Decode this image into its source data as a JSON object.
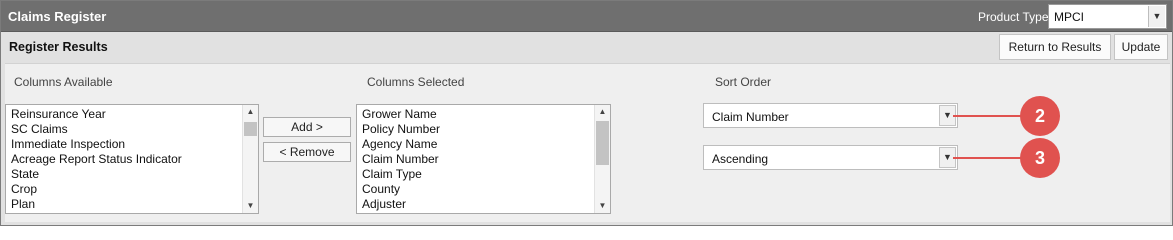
{
  "header": {
    "title": "Claims Register",
    "product_type_label": "Product Type",
    "product_type_value": "MPCI"
  },
  "results": {
    "title": "Register Results",
    "return_label": "Return to Results",
    "update_label": "Update"
  },
  "columns_available": {
    "heading": "Columns Available",
    "items": [
      "Reinsurance Year",
      "SC Claims",
      "Immediate Inspection",
      "Acreage Report Status Indicator",
      "State",
      "Crop",
      "Plan"
    ]
  },
  "actions": {
    "add_label": "Add >",
    "remove_label": "< Remove"
  },
  "columns_selected": {
    "heading": "Columns Selected",
    "items": [
      "Grower Name",
      "Policy Number",
      "Agency Name",
      "Claim Number",
      "Claim Type",
      "County",
      "Adjuster"
    ]
  },
  "sort": {
    "heading": "Sort Order",
    "field_value": "Claim Number",
    "direction_value": "Ascending"
  },
  "callouts": {
    "sort_field": "2",
    "sort_direction": "3",
    "color": "#e0524f"
  }
}
